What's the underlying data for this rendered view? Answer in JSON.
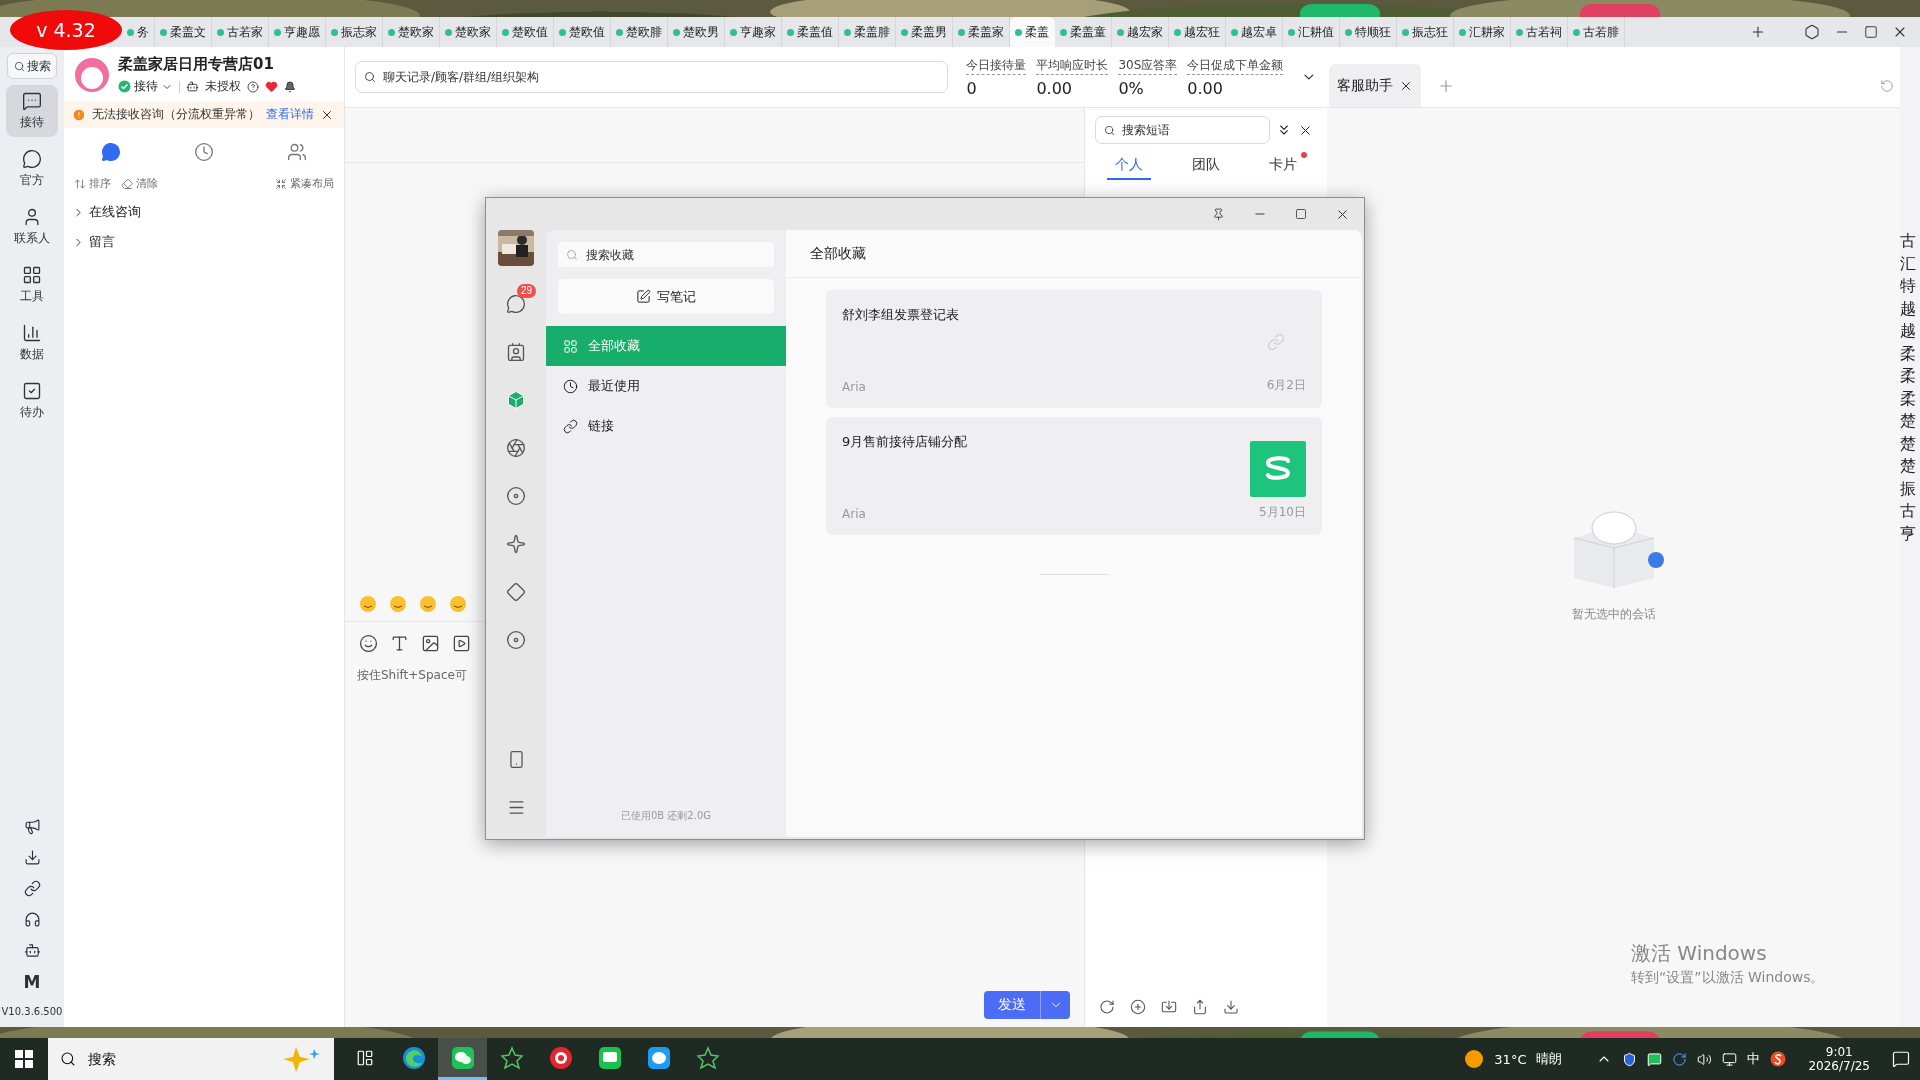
{
  "version_badge": "v 4.32",
  "shop_tabs": [
    {
      "label": "务",
      "selected": false
    },
    {
      "label": "柔盖文",
      "selected": false
    },
    {
      "label": "古若家",
      "selected": false
    },
    {
      "label": "亨趣愿",
      "selected": false
    },
    {
      "label": "振志家",
      "selected": false
    },
    {
      "label": "楚欧家",
      "selected": false
    },
    {
      "label": "楚欧家",
      "selected": false
    },
    {
      "label": "楚欧值",
      "selected": false
    },
    {
      "label": "楚欧值",
      "selected": false
    },
    {
      "label": "楚欧腓",
      "selected": false
    },
    {
      "label": "楚欧男",
      "selected": false
    },
    {
      "label": "亨趣家",
      "selected": false
    },
    {
      "label": "柔盖值",
      "selected": false
    },
    {
      "label": "柔盖腓",
      "selected": false
    },
    {
      "label": "柔盖男",
      "selected": false
    },
    {
      "label": "柔盖家",
      "selected": false
    },
    {
      "label": "柔盖",
      "selected": true
    },
    {
      "label": "柔盖童",
      "selected": false
    },
    {
      "label": "越宏家",
      "selected": false
    },
    {
      "label": "越宏狂",
      "selected": false
    },
    {
      "label": "越宏卓",
      "selected": false
    },
    {
      "label": "汇耕值",
      "selected": false
    },
    {
      "label": "特顺狂",
      "selected": false
    },
    {
      "label": "振志狂",
      "selected": false
    },
    {
      "label": "汇耕家",
      "selected": false
    },
    {
      "label": "古若祠",
      "selected": false
    },
    {
      "label": "古若腓",
      "selected": false
    }
  ],
  "nav": {
    "search": "搜索",
    "items": [
      {
        "label": "接待",
        "kind": "reception",
        "selected": true
      },
      {
        "label": "官方",
        "kind": "official",
        "selected": false
      },
      {
        "label": "联系人",
        "kind": "contacts",
        "selected": false
      },
      {
        "label": "工具",
        "kind": "tools",
        "selected": false
      },
      {
        "label": "数据",
        "kind": "data",
        "selected": false
      },
      {
        "label": "待办",
        "kind": "todo",
        "selected": false
      }
    ],
    "mark": "M",
    "version": "V10.3.6.500"
  },
  "shop": {
    "name": "柔盖家居日用专营店01",
    "status": "接待",
    "auth": "未授权"
  },
  "alert": {
    "text": "无法接收咨询（分流权重异常）",
    "link": "查看详情"
  },
  "list_tabs": [
    {
      "kind": "chat",
      "selected": true
    },
    {
      "kind": "history",
      "selected": false
    },
    {
      "kind": "team",
      "selected": false
    }
  ],
  "list_actions": [
    {
      "kind": "sort",
      "label": "排序"
    },
    {
      "kind": "clear",
      "label": "清除"
    },
    {
      "kind": "compact",
      "label": "紧凑布局"
    }
  ],
  "groups": [
    {
      "label": "在线咨询",
      "expanded": false
    },
    {
      "label": "留言",
      "expanded": false
    }
  ],
  "chat": {
    "search_placeholder": "聊天记录/顾客/群组/组织架构",
    "stats": [
      {
        "label": "今日接待量",
        "value": "0"
      },
      {
        "label": "平均响应时长",
        "value": "0.00"
      },
      {
        "label": "30S应答率",
        "value": "0%"
      },
      {
        "label": "今日促成下单金额",
        "value": "0.00"
      }
    ],
    "input_placeholder": "按住Shift+Space可",
    "send": "发送"
  },
  "phrases": {
    "search_placeholder": "搜索短语",
    "tabs": [
      {
        "label": "个人",
        "selected": true,
        "dot": false
      },
      {
        "label": "团队",
        "selected": false,
        "dot": false
      },
      {
        "label": "卡片",
        "selected": false,
        "dot": true
      }
    ]
  },
  "assistant": {
    "tabs": [
      {
        "label": "客服助手",
        "selected": true
      }
    ],
    "empty_text": "暂无选中的会话"
  },
  "side_chars": [
    "古",
    "汇",
    "特",
    "越",
    "越",
    "柔",
    "柔",
    "柔",
    "楚",
    "楚",
    "楚",
    "振",
    "古",
    "亨"
  ],
  "activation": {
    "title": "激活 Windows",
    "text": "转到“设置”以激活 Windows。"
  },
  "favorites": {
    "rail": [
      {
        "kind": "chats",
        "selected": false,
        "badge": "29"
      },
      {
        "kind": "contacts",
        "selected": false
      },
      {
        "kind": "favorites",
        "selected": true
      },
      {
        "kind": "moments",
        "selected": false
      },
      {
        "kind": "channels",
        "selected": false
      },
      {
        "kind": "sparkle",
        "selected": false
      },
      {
        "kind": "search",
        "selected": false
      },
      {
        "kind": "mini",
        "selected": false
      }
    ],
    "search_placeholder": "搜索收藏",
    "write_note": "写笔记",
    "nav": [
      {
        "label": "全部收藏",
        "kind": "all",
        "selected": true
      },
      {
        "label": "最近使用",
        "kind": "recent",
        "selected": false
      },
      {
        "label": "链接",
        "kind": "link",
        "selected": false
      }
    ],
    "storage": "已使用0B 还剩2.0G",
    "title": "全部收藏",
    "items": [
      {
        "title": "舒刘李组发票登记表",
        "author": "Aria",
        "date": "6月2日",
        "kind": "link"
      },
      {
        "title": "9月售前接待店铺分配",
        "author": "Aria",
        "date": "5月10日",
        "kind": "sheet"
      }
    ]
  },
  "taskbar": {
    "search": {
      "placeholder": "搜索"
    },
    "apps": [
      {
        "kind": "edge",
        "selected": false
      },
      {
        "kind": "wechat",
        "selected": true
      },
      {
        "kind": "star",
        "selected": false
      },
      {
        "kind": "red",
        "selected": false
      },
      {
        "kind": "greenchat",
        "selected": false
      },
      {
        "kind": "bluechat",
        "selected": false
      },
      {
        "kind": "star",
        "selected": false
      }
    ],
    "temperature": "31°C",
    "weather": "晴朗",
    "ime": "中",
    "time": "9:01",
    "date": "2026/7/25"
  }
}
